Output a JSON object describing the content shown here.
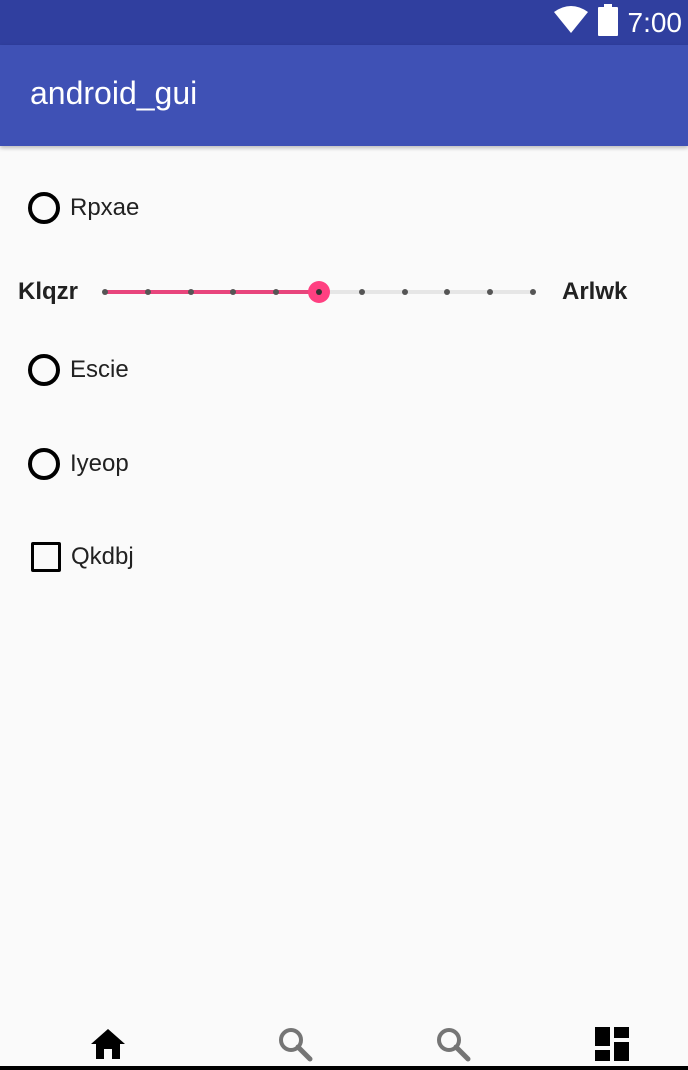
{
  "status_bar": {
    "time": "7:00",
    "icons": [
      "wifi-icon",
      "battery-icon"
    ]
  },
  "app_bar": {
    "title": "android_gui",
    "color": "#3f51b5",
    "status_color": "#303f9f"
  },
  "options": [
    {
      "type": "radio",
      "label": "Rpxae",
      "checked": false
    },
    {
      "type": "radio",
      "label": "Escie",
      "checked": false
    },
    {
      "type": "radio",
      "label": "Iyeop",
      "checked": false
    },
    {
      "type": "checkbox",
      "label": "Qkdbj",
      "checked": false
    }
  ],
  "slider": {
    "min_label": "Klqzr",
    "max_label": "Arlwk",
    "steps": 10,
    "value": 5,
    "accent_color": "#ff4081"
  },
  "bottom_nav": {
    "items": [
      {
        "icon": "home-icon",
        "active": true
      },
      {
        "icon": "search-icon",
        "active": false
      },
      {
        "icon": "search-icon",
        "active": false
      },
      {
        "icon": "dashboard-icon",
        "active": true
      }
    ]
  }
}
